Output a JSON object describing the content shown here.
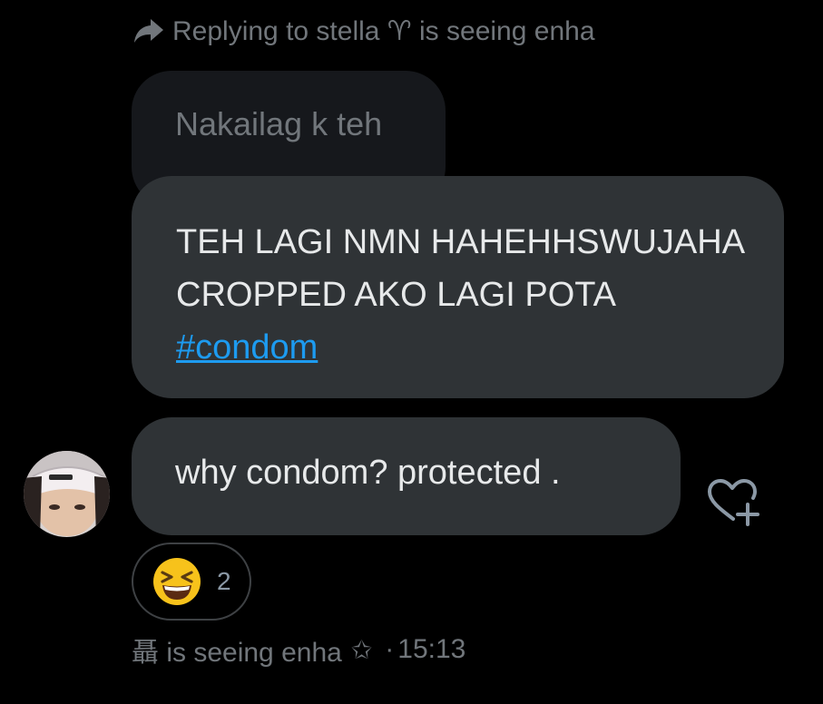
{
  "reply_context": {
    "text": "Replying to stella ♈ is seeing enha",
    "icon": "reply-arrow-icon"
  },
  "quoted_message": {
    "text": "Nakailag k teh"
  },
  "reply_message": {
    "text": "TEH LAGI NMN HAHEHHSWUJAHA CROPPED AKO LAGI POTA ",
    "hashtag": "#condom"
  },
  "message": {
    "text": "why condom? protected ."
  },
  "reaction": {
    "emoji": "grinning-squinting-face",
    "count": "2"
  },
  "add_reaction_icon": "heart-plus-icon",
  "meta": {
    "sender": "聶 is seeing enha",
    "star": "✩",
    "separator": "·",
    "time": "15:13"
  },
  "colors": {
    "background": "#000000",
    "bubble": "#2f3336",
    "quoted_bubble": "#16181c",
    "text": "#e7e9ea",
    "muted": "#71767b",
    "link": "#1d9bf0"
  }
}
